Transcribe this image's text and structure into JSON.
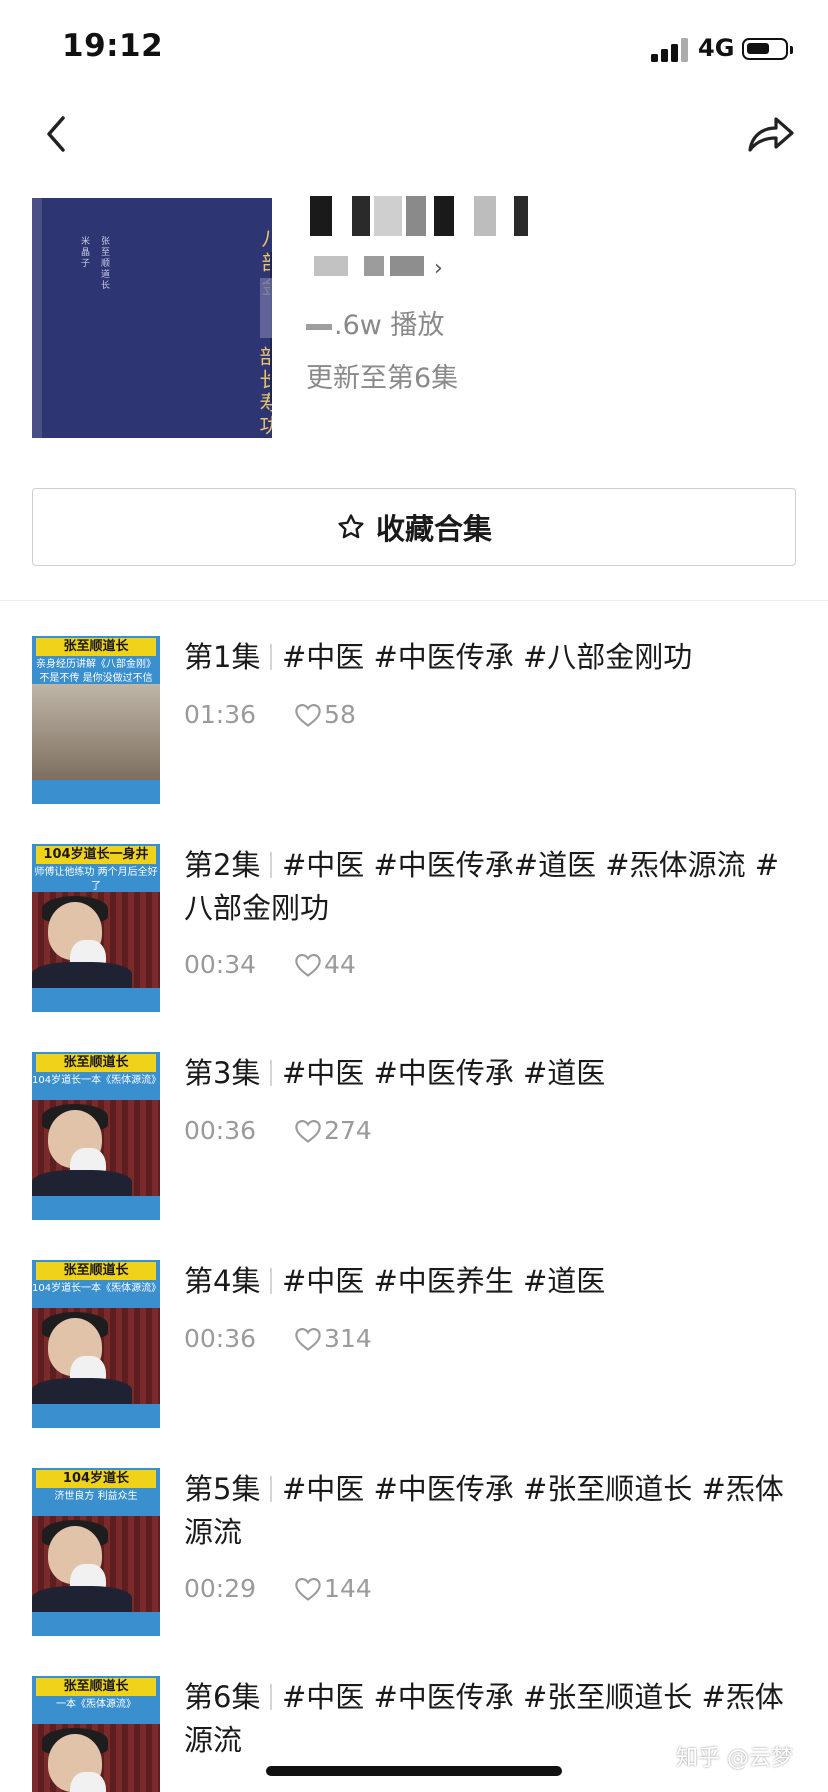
{
  "status_bar": {
    "time": "19:12",
    "network": "4G"
  },
  "header": {
    "cover_title_top": "八部金",
    "cover_title_bottom": "部长寿功",
    "cover_author": "米晶子",
    "cover_subtitle": "张至顺道长",
    "plays": ".6w 播放",
    "update_status": "更新至第6集"
  },
  "favorite_button": {
    "label": "收藏合集"
  },
  "episodes": [
    {
      "number": "第1集",
      "tags": "#中医 #中医传承 #八部金刚功",
      "duration": "01:36",
      "likes": "58",
      "thumb_banner": "张至顺道长",
      "thumb_caption": "亲身经历讲解《八部金刚》不是不传 是你没做过不信",
      "thumb_foot": ""
    },
    {
      "number": "第2集",
      "tags": "#中医 #中医传承#道医 #炁体源流 #八部金刚功",
      "duration": "00:34",
      "likes": "44",
      "thumb_banner": "104岁道长一身井",
      "thumb_caption": "师傅让他练功 两个月后全好了",
      "thumb_foot": ""
    },
    {
      "number": "第3集",
      "tags": "#中医 #中医传承 #道医",
      "duration": "00:36",
      "likes": "274",
      "thumb_banner": "张至顺道长",
      "thumb_caption": "104岁道长一本《炁体源流》",
      "thumb_foot": ""
    },
    {
      "number": "第4集",
      "tags": "#中医 #中医养生 #道医",
      "duration": "00:36",
      "likes": "314",
      "thumb_banner": "张至顺道长",
      "thumb_caption": "104岁道长一本《炁体源流》",
      "thumb_foot": ""
    },
    {
      "number": "第5集",
      "tags": "#中医 #中医传承 #张至顺道长 #炁体源流",
      "duration": "00:29",
      "likes": "144",
      "thumb_banner": "104岁道长",
      "thumb_caption": "济世良方 利益众生",
      "thumb_foot": ""
    },
    {
      "number": "第6集",
      "tags": "#中医 #中医传承 #张至顺道长 #炁体源流",
      "duration": "",
      "likes": "",
      "thumb_banner": "张至顺道长",
      "thumb_caption": "一本《炁体源流》",
      "thumb_foot": ""
    }
  ],
  "watermark": "知乎 @云梦"
}
